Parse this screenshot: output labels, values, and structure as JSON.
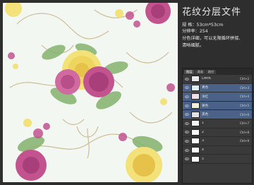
{
  "header": {
    "title": "花纹分层文件",
    "size_line": "规 格：53cm*53cm",
    "resolution_line": "分辨率：254",
    "desc_line_1": "分色详细，可以无限循环拼接,",
    "desc_line_2": "清晰细腻。"
  },
  "layers_panel": {
    "tabs": [
      "图层",
      "通道",
      "路径"
    ],
    "active_tab_index": 0,
    "layers": [
      {
        "label": "CMYK",
        "shortcut": "Ctrl+2",
        "thumb": "#e8e8e8",
        "selected": false
      },
      {
        "label": "青色",
        "shortcut": "Ctrl+3",
        "thumb": "#dfeef5",
        "selected": true
      },
      {
        "label": "洋红",
        "shortcut": "Ctrl+4",
        "thumb": "#f0dfe8",
        "selected": true
      },
      {
        "label": "黄色",
        "shortcut": "Ctrl+5",
        "thumb": "#f4f0d8",
        "selected": true
      },
      {
        "label": "黑色",
        "shortcut": "Ctrl+6",
        "thumb": "#e3e3e3",
        "selected": true
      },
      {
        "label": "1",
        "shortcut": "Ctrl+7",
        "thumb": "#f2f2f2",
        "selected": false
      },
      {
        "label": "2",
        "shortcut": "Ctrl+8",
        "thumb": "#f6f6f6",
        "selected": false
      },
      {
        "label": "3",
        "shortcut": "Ctrl+9",
        "thumb": "#fbfbfb",
        "selected": false
      },
      {
        "label": "4",
        "shortcut": "",
        "thumb": "#fcfcfc",
        "selected": false
      },
      {
        "label": "5",
        "shortcut": "",
        "thumb": "#fdfdfd",
        "selected": false
      }
    ]
  },
  "colors": {
    "background": "#2e2e2e",
    "selected_row": "#4a6287",
    "fabric_base": "#f3f7f2",
    "rose_pink": "#c2538f",
    "peony_yellow": "#f2e279",
    "leaf_green": "#84b26e",
    "scroll_gold": "#b8a06b"
  }
}
